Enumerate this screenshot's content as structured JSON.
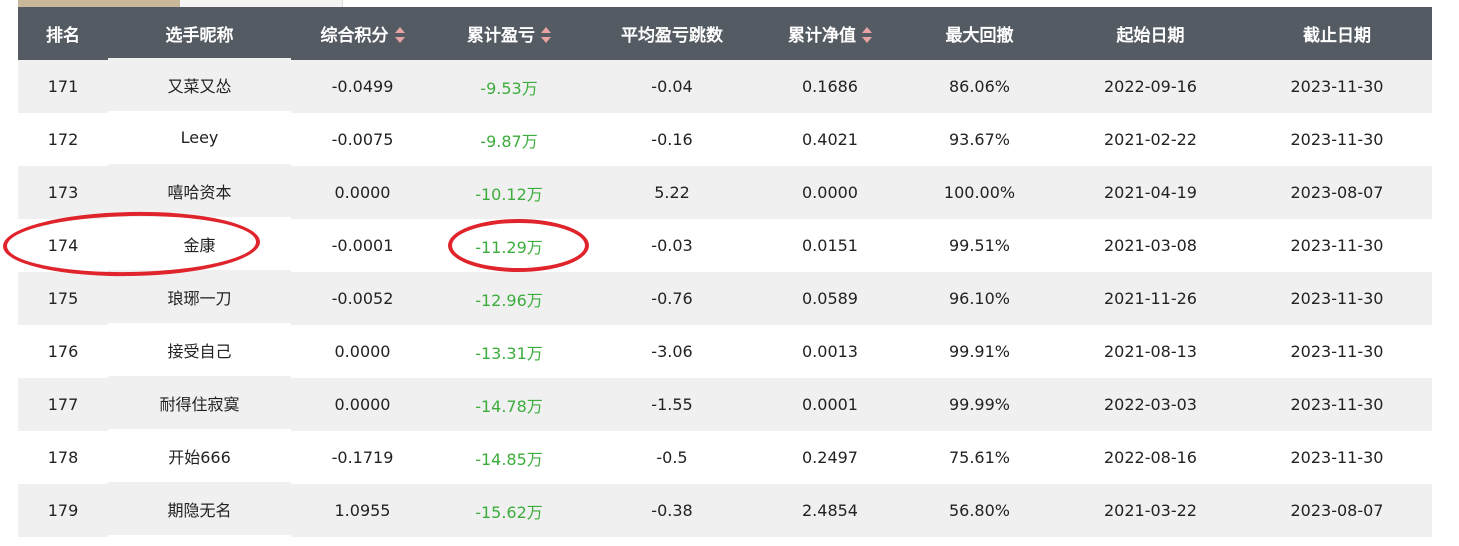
{
  "columns": [
    {
      "label": "排名",
      "sortable": false
    },
    {
      "label": "选手昵称",
      "sortable": false
    },
    {
      "label": "综合积分",
      "sortable": true
    },
    {
      "label": "累计盈亏",
      "sortable": true
    },
    {
      "label": "平均盈亏跳数",
      "sortable": false
    },
    {
      "label": "累计净值",
      "sortable": true
    },
    {
      "label": "最大回撤",
      "sortable": false
    },
    {
      "label": "起始日期",
      "sortable": false
    },
    {
      "label": "截止日期",
      "sortable": false
    }
  ],
  "rows": [
    {
      "rank": "171",
      "name": "又菜又怂",
      "score": "-0.0499",
      "pnl": "-9.53万",
      "avg_ticks": "-0.04",
      "nav": "0.1686",
      "drawdown": "86.06%",
      "start": "2022-09-16",
      "end": "2023-11-30"
    },
    {
      "rank": "172",
      "name": "Leey",
      "score": "-0.0075",
      "pnl": "-9.87万",
      "avg_ticks": "-0.16",
      "nav": "0.4021",
      "drawdown": "93.67%",
      "start": "2021-02-22",
      "end": "2023-11-30"
    },
    {
      "rank": "173",
      "name": "嘻哈资本",
      "score": "0.0000",
      "pnl": "-10.12万",
      "avg_ticks": "5.22",
      "nav": "0.0000",
      "drawdown": "100.00%",
      "start": "2021-04-19",
      "end": "2023-08-07"
    },
    {
      "rank": "174",
      "name": "金康",
      "score": "-0.0001",
      "pnl": "-11.29万",
      "avg_ticks": "-0.03",
      "nav": "0.0151",
      "drawdown": "99.51%",
      "start": "2021-03-08",
      "end": "2023-11-30"
    },
    {
      "rank": "175",
      "name": "琅琊一刀",
      "score": "-0.0052",
      "pnl": "-12.96万",
      "avg_ticks": "-0.76",
      "nav": "0.0589",
      "drawdown": "96.10%",
      "start": "2021-11-26",
      "end": "2023-11-30"
    },
    {
      "rank": "176",
      "name": "接受自己",
      "score": "0.0000",
      "pnl": "-13.31万",
      "avg_ticks": "-3.06",
      "nav": "0.0013",
      "drawdown": "99.91%",
      "start": "2021-08-13",
      "end": "2023-11-30"
    },
    {
      "rank": "177",
      "name": "耐得住寂寞",
      "score": "0.0000",
      "pnl": "-14.78万",
      "avg_ticks": "-1.55",
      "nav": "0.0001",
      "drawdown": "99.99%",
      "start": "2022-03-03",
      "end": "2023-11-30"
    },
    {
      "rank": "178",
      "name": "开始666",
      "score": "-0.1719",
      "pnl": "-14.85万",
      "avg_ticks": "-0.5",
      "nav": "0.2497",
      "drawdown": "75.61%",
      "start": "2022-08-16",
      "end": "2023-11-30"
    },
    {
      "rank": "179",
      "name": "期隐无名",
      "score": "1.0955",
      "pnl": "-15.62万",
      "avg_ticks": "-0.38",
      "nav": "2.4854",
      "drawdown": "56.80%",
      "start": "2021-03-22",
      "end": "2023-08-07"
    }
  ],
  "colors": {
    "header_bg": "#545b62",
    "header_text": "#ffffff",
    "row_alt_bg": "#f0f0f0",
    "pnl_negative": "#3cad3c",
    "sort_arrow": "#e7a4a4",
    "annotation": "#e0242c",
    "tab_active": "#c9b99a"
  },
  "icons": {
    "sort": "sort-updown-icon"
  },
  "highlighted_rank": "174"
}
